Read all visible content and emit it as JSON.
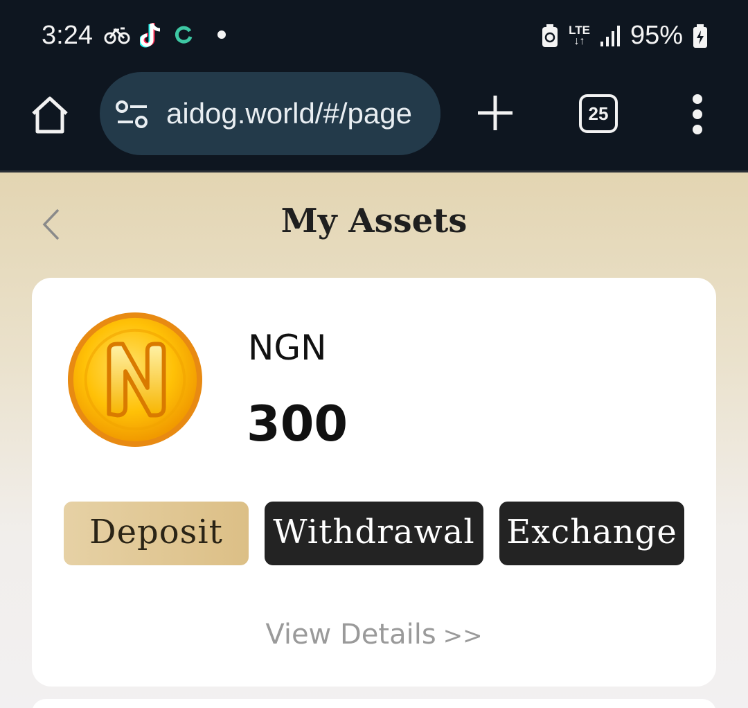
{
  "status_bar": {
    "time": "3:24",
    "network": "LTE",
    "battery": "95%",
    "icons": [
      "bike-icon",
      "tiktok-icon",
      "sync-icon",
      "notification-dot",
      "battery-saver-icon",
      "lte-icon",
      "signal-icon",
      "battery-charging-icon"
    ]
  },
  "browser": {
    "url": "aidog.world/#/page",
    "tab_count": "25",
    "icons": [
      "home-icon",
      "tune-icon",
      "plus-icon",
      "more-vert-icon"
    ]
  },
  "page": {
    "title": "My Assets",
    "back_icon": "chevron-left-icon"
  },
  "asset": {
    "currency": "NGN",
    "amount": "300",
    "coin_letter": "N",
    "buttons": {
      "deposit": "Deposit",
      "withdrawal": "Withdrawal",
      "exchange": "Exchange"
    },
    "view_details": "View Details",
    "view_details_icon": ">>"
  },
  "colors": {
    "status_bg": "#0e1620",
    "url_bar_bg": "#233a4a",
    "deposit_button": "#e6d1a5",
    "dark_button": "#232323",
    "coin_gold": "#f7b500"
  }
}
